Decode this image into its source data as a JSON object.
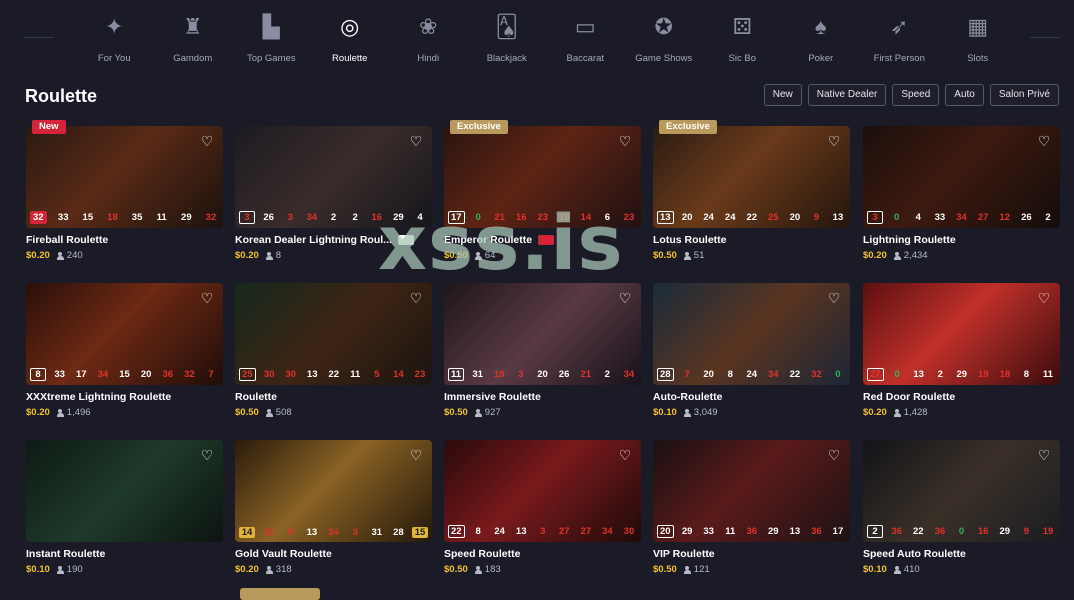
{
  "nav": {
    "categories": [
      {
        "label": "For You",
        "icon": "sparkle-icon",
        "active": false
      },
      {
        "label": "Gamdom",
        "icon": "castle-icon",
        "active": false
      },
      {
        "label": "Top Games",
        "icon": "podium-icon",
        "active": false
      },
      {
        "label": "Roulette",
        "icon": "roulette-wheel-icon",
        "active": true
      },
      {
        "label": "Hindi",
        "icon": "lotus-icon",
        "active": false
      },
      {
        "label": "Blackjack",
        "icon": "cards-icon",
        "active": false
      },
      {
        "label": "Baccarat",
        "icon": "baccarat-table-icon",
        "active": false
      },
      {
        "label": "Game Shows",
        "icon": "microphone-icon",
        "active": false
      },
      {
        "label": "Sic Bo",
        "icon": "dice-icon",
        "active": false
      },
      {
        "label": "Poker",
        "icon": "poker-chip-icon",
        "active": false
      },
      {
        "label": "First Person",
        "icon": "first-person-icon",
        "active": false
      },
      {
        "label": "Slots",
        "icon": "slot-machine-icon",
        "active": false
      }
    ]
  },
  "page": {
    "title": "Roulette",
    "watermark": "xss.is"
  },
  "filters": [
    "New",
    "Native Dealer",
    "Speed",
    "Auto",
    "Salon Privé"
  ],
  "colors": {
    "price": "#f2c230",
    "red": "#e0322c",
    "green": "#2db35a",
    "badge_new": "#d4243a",
    "badge_exclusive": "#b89a5c"
  },
  "games": [
    {
      "name": "Fireball Roulette",
      "price": "$0.20",
      "players": "240",
      "badge": "New",
      "nums": [
        "32",
        "33",
        "15",
        "18",
        "35",
        "11",
        "29",
        "32"
      ],
      "bg": "linear-gradient(135deg,#2a1a12,#5a2a16 45%,#1b120d)"
    },
    {
      "name": "Korean Dealer Lightning Roul...",
      "price": "$0.20",
      "players": "8",
      "badge": "",
      "flag": "korea",
      "nums": [
        "3",
        "26",
        "3",
        "34",
        "2",
        "2",
        "16",
        "29",
        "4"
      ],
      "bg": "linear-gradient(135deg,#1c1b22,#3a2c2a 50%,#15161c)"
    },
    {
      "name": "Emperor Roulette",
      "price": "$0.50",
      "players": "64",
      "badge": "Exclusive",
      "flag": "china",
      "nums": [
        "17",
        "0",
        "21",
        "16",
        "23",
        "19",
        "14",
        "6",
        "23"
      ],
      "bg": "linear-gradient(135deg,#2b1410,#5e2414 45%,#201012)"
    },
    {
      "name": "Lotus Roulette",
      "price": "$0.50",
      "players": "51",
      "badge": "Exclusive",
      "nums": [
        "13",
        "20",
        "24",
        "24",
        "22",
        "25",
        "20",
        "9",
        "13"
      ],
      "bg": "linear-gradient(135deg,#2a1c12,#6a3a1a 45%,#24160d)"
    },
    {
      "name": "Lightning Roulette",
      "price": "$0.20",
      "players": "2,434",
      "badge": "",
      "nums": [
        "3",
        "0",
        "4",
        "33",
        "34",
        "27",
        "12",
        "26",
        "2"
      ],
      "bg": "linear-gradient(135deg,#1b0f0c,#3d1a10 45%,#140c0a)"
    },
    {
      "name": "XXXtreme Lightning Roulette",
      "price": "$0.20",
      "players": "1,496",
      "badge": "",
      "nums": [
        "8",
        "33",
        "17",
        "34",
        "15",
        "20",
        "36",
        "32",
        "7"
      ],
      "bg": "linear-gradient(135deg,#2a0f0a,#6e2a14 45%,#1f0c08)"
    },
    {
      "name": "Roulette",
      "price": "$0.50",
      "players": "508",
      "badge": "",
      "nums": [
        "25",
        "30",
        "30",
        "13",
        "22",
        "11",
        "5",
        "14",
        "23"
      ],
      "bg": "linear-gradient(135deg,#14281c,#3e2414 50%,#1a1410)"
    },
    {
      "name": "Immersive Roulette",
      "price": "$0.50",
      "players": "927",
      "badge": "",
      "nums": [
        "11",
        "31",
        "19",
        "3",
        "20",
        "26",
        "21",
        "2",
        "34"
      ],
      "bg": "linear-gradient(135deg,#1e1618,#5a3a44 50%,#18121a)"
    },
    {
      "name": "Auto-Roulette",
      "price": "$0.10",
      "players": "3,049",
      "badge": "",
      "nums": [
        "28",
        "7",
        "20",
        "8",
        "24",
        "34",
        "22",
        "32",
        "0"
      ],
      "bg": "linear-gradient(135deg,#1a2c3a,#5a3420 50%,#1c2636)"
    },
    {
      "name": "Red Door Roulette",
      "price": "$0.20",
      "players": "1,428",
      "badge": "",
      "nums": [
        "27",
        "0",
        "13",
        "2",
        "29",
        "19",
        "18",
        "8",
        "11"
      ],
      "bg": "linear-gradient(135deg,#5a1010,#c0302a 45%,#3a0c0c)"
    },
    {
      "name": "Instant Roulette",
      "price": "$0.10",
      "players": "190",
      "badge": "",
      "nums": [],
      "bg": "linear-gradient(135deg,#0e1a14,#1e3a2a 50%,#0c1410)"
    },
    {
      "name": "Gold Vault Roulette",
      "price": "$0.20",
      "players": "318",
      "badge": "",
      "nums": [
        "14",
        "12",
        "5",
        "13",
        "34",
        "3",
        "31",
        "28",
        "15"
      ],
      "bg": "linear-gradient(135deg,#2a1c0c,#8a6224 45%,#24180a)"
    },
    {
      "name": "Speed Roulette",
      "price": "$0.50",
      "players": "183",
      "badge": "",
      "nums": [
        "22",
        "8",
        "24",
        "13",
        "3",
        "27",
        "27",
        "34",
        "30"
      ],
      "bg": "linear-gradient(135deg,#2a0a0c,#7a1a1c 45%,#1e0a0a)"
    },
    {
      "name": "VIP Roulette",
      "price": "$0.50",
      "players": "121",
      "badge": "",
      "nums": [
        "20",
        "29",
        "33",
        "11",
        "36",
        "29",
        "13",
        "36",
        "17"
      ],
      "bg": "linear-gradient(135deg,#1a1012,#5a1a1a 45%,#1e1214)"
    },
    {
      "name": "Speed Auto Roulette",
      "price": "$0.10",
      "players": "410",
      "badge": "",
      "nums": [
        "2",
        "36",
        "22",
        "36",
        "0",
        "16",
        "29",
        "9",
        "19"
      ],
      "bg": "linear-gradient(135deg,#121418,#3a3028 50%,#1a1c22)"
    }
  ]
}
